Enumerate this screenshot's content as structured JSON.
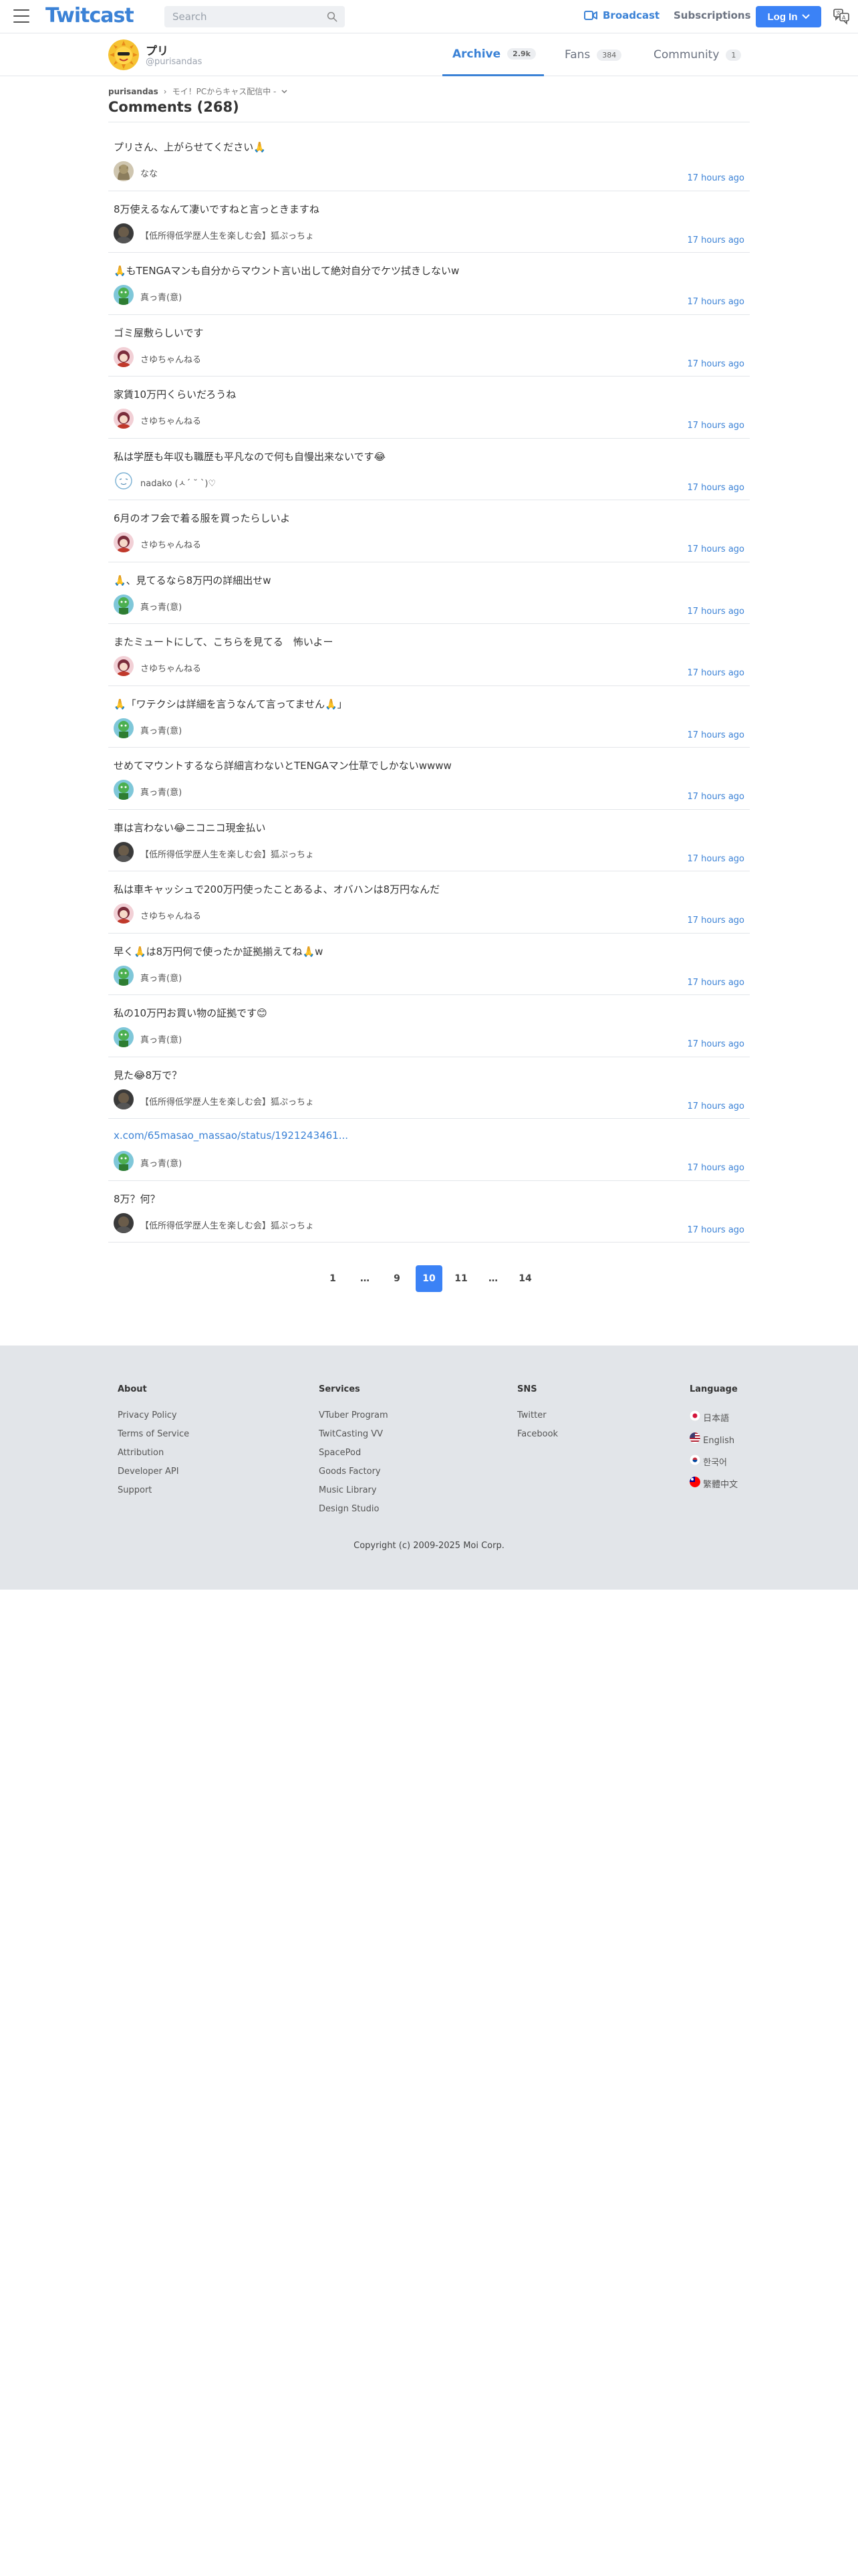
{
  "header": {
    "logo": "Twitcast",
    "search_placeholder": "Search",
    "broadcast_label": "Broadcast",
    "subscriptions_label": "Subscriptions",
    "login_label": "Log In",
    "accent_color": "#3b82f6"
  },
  "profile": {
    "name": "プリ",
    "handle": "@purisandas",
    "tabs": [
      {
        "label": "Archive",
        "count": "2.9k",
        "active": true
      },
      {
        "label": "Fans",
        "count": "384",
        "active": false
      },
      {
        "label": "Community",
        "count": "1",
        "active": false
      }
    ]
  },
  "breadcrumb": {
    "user": "purisandas",
    "separator": "›",
    "movie": "モイ！PCからキャス配信中 -"
  },
  "page_title": "Comments (268)",
  "comments": [
    {
      "text": "プリさん、上がらせてください🙏",
      "user": "なな",
      "time": "17 hours ago",
      "avatar": "cat",
      "link": false
    },
    {
      "text": "8万使えるなんて凄いですねと言っときますね",
      "user": "【低所得低学歴人生を楽しむ会】狐ぷっちょ",
      "time": "17 hours ago",
      "avatar": "dark",
      "link": false
    },
    {
      "text": "🙏もTENGAマンも自分からマウント言い出して絶対自分でケツ拭きしないw",
      "user": "真っ青(意)",
      "time": "17 hours ago",
      "avatar": "green",
      "link": false
    },
    {
      "text": "ゴミ屋敷らしいです",
      "user": "さゆちゃんねる",
      "time": "17 hours ago",
      "avatar": "anime",
      "link": false
    },
    {
      "text": "家賃10万円くらいだろうね",
      "user": "さゆちゃんねる",
      "time": "17 hours ago",
      "avatar": "anime",
      "link": false
    },
    {
      "text": "私は学歴も年収も職歴も平凡なので何も自慢出来ないです😂",
      "user": "nadako (ㅅ´ ˘ `)♡",
      "time": "17 hours ago",
      "avatar": "face",
      "link": false
    },
    {
      "text": "6月のオフ会で着る服を買ったらしいよ",
      "user": "さゆちゃんねる",
      "time": "17 hours ago",
      "avatar": "anime",
      "link": false
    },
    {
      "text": "🙏、見てるなら8万円の詳細出せw",
      "user": "真っ青(意)",
      "time": "17 hours ago",
      "avatar": "green",
      "link": false
    },
    {
      "text": "またミュートにして、こちらを見てる　怖いよー",
      "user": "さゆちゃんねる",
      "time": "17 hours ago",
      "avatar": "anime",
      "link": false
    },
    {
      "text": "🙏「ワテクシは詳細を言うなんて言ってません🙏」",
      "user": "真っ青(意)",
      "time": "17 hours ago",
      "avatar": "green",
      "link": false
    },
    {
      "text": "せめてマウントするなら詳細言わないとTENGAマン仕草でしかないwwww",
      "user": "真っ青(意)",
      "time": "17 hours ago",
      "avatar": "green",
      "link": false
    },
    {
      "text": "車は言わない😂ニコニコ現金払い",
      "user": "【低所得低学歴人生を楽しむ会】狐ぷっちょ",
      "time": "17 hours ago",
      "avatar": "dark",
      "link": false
    },
    {
      "text": "私は車キャッシュで200万円使ったことあるよ、オバハンは8万円なんだ",
      "user": "さゆちゃんねる",
      "time": "17 hours ago",
      "avatar": "anime",
      "link": false
    },
    {
      "text": "早く🙏は8万円何で使ったか証拠揃えてね🙏w",
      "user": "真っ青(意)",
      "time": "17 hours ago",
      "avatar": "green",
      "link": false
    },
    {
      "text": "私の10万円お買い物の証拠です😊",
      "user": "真っ青(意)",
      "time": "17 hours ago",
      "avatar": "green",
      "link": false
    },
    {
      "text": "見た😂8万で？",
      "user": "【低所得低学歴人生を楽しむ会】狐ぷっちょ",
      "time": "17 hours ago",
      "avatar": "dark",
      "link": false
    },
    {
      "text": "x.com/65masao_massao/status/1921243461...",
      "user": "真っ青(意)",
      "time": "17 hours ago",
      "avatar": "green",
      "link": true
    },
    {
      "text": "8万？何？",
      "user": "【低所得低学歴人生を楽しむ会】狐ぷっちょ",
      "time": "17 hours ago",
      "avatar": "dark",
      "link": false
    }
  ],
  "pagination": [
    {
      "label": "1",
      "active": false
    },
    {
      "label": "…",
      "active": false
    },
    {
      "label": "9",
      "active": false
    },
    {
      "label": "10",
      "active": true
    },
    {
      "label": "11",
      "active": false
    },
    {
      "label": "…",
      "active": false
    },
    {
      "label": "14",
      "active": false
    }
  ],
  "footer": {
    "about": {
      "heading": "About",
      "links": [
        "Privacy Policy",
        "Terms of Service",
        "Attribution",
        "Developer API",
        "Support"
      ]
    },
    "services": {
      "heading": "Services",
      "links": [
        "VTuber Program",
        "TwitCasting VV",
        "SpacePod",
        "Goods Factory",
        "Music Library",
        "Design Studio"
      ]
    },
    "sns": {
      "heading": "SNS",
      "links": [
        "Twitter",
        "Facebook"
      ]
    },
    "language": {
      "heading": "Language",
      "links": [
        "日本語",
        "English",
        "한국어",
        "繁體中文"
      ]
    },
    "copyright": "Copyright (c) 2009-2025 Moi Corp."
  }
}
